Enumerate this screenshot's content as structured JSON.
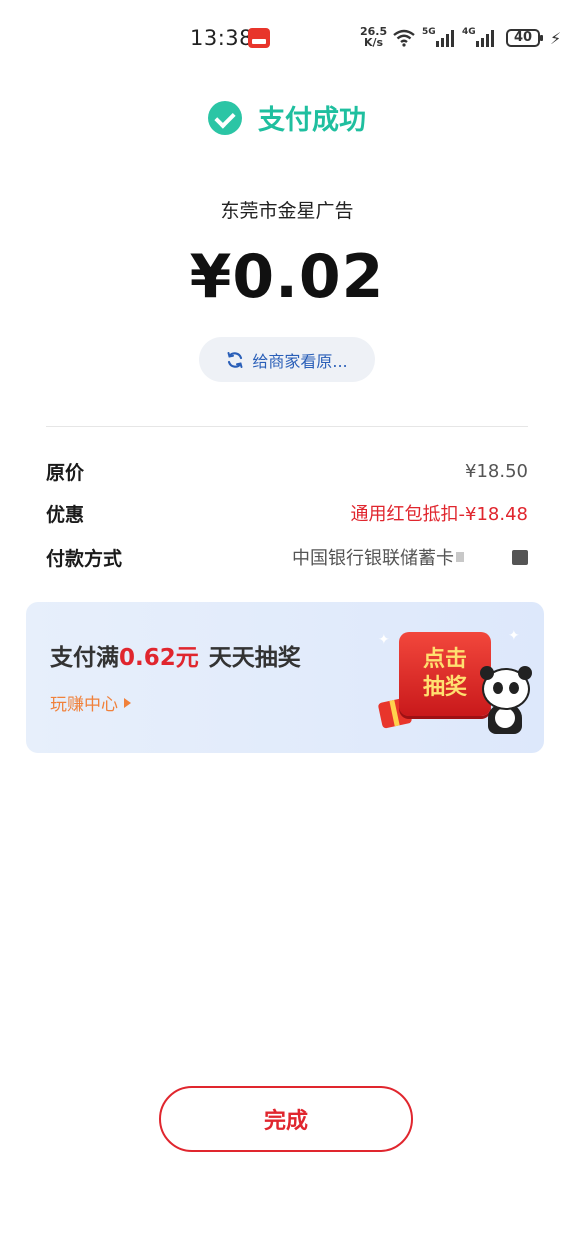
{
  "status_bar": {
    "time": "13:38",
    "net_speed_value": "26.5",
    "net_speed_unit": "K/s",
    "signal1_tag": "5G",
    "signal2_tag": "4G",
    "battery": "40"
  },
  "header": {
    "title": "支付成功"
  },
  "payment": {
    "merchant": "东莞市金星广告",
    "amount": "¥0.02",
    "view_button_label": "给商家看原..."
  },
  "details": [
    {
      "label": "原价",
      "value": "¥18.50"
    },
    {
      "label": "优惠",
      "value": "通用红包抵扣-¥18.48"
    },
    {
      "label": "付款方式",
      "value": "中国银行银联储蓄卡"
    }
  ],
  "promo": {
    "prefix": "支付满",
    "amount": "0.62元",
    "suffix": "天天抽奖",
    "link_label": "玩赚中心",
    "prize_line1": "点击",
    "prize_line2": "抽奖"
  },
  "footer": {
    "done_label": "完成"
  },
  "colors": {
    "success": "#2bc5a5",
    "accent_red": "#e0262e",
    "link_blue": "#2a5fb8",
    "promo_orange": "#f0813b"
  },
  "icons": [
    "check-circle-icon",
    "refresh-icon",
    "play-triangle-icon",
    "gift-icon",
    "panda-mascot-icon",
    "wifi-icon",
    "signal-icon",
    "battery-icon",
    "charging-icon"
  ]
}
